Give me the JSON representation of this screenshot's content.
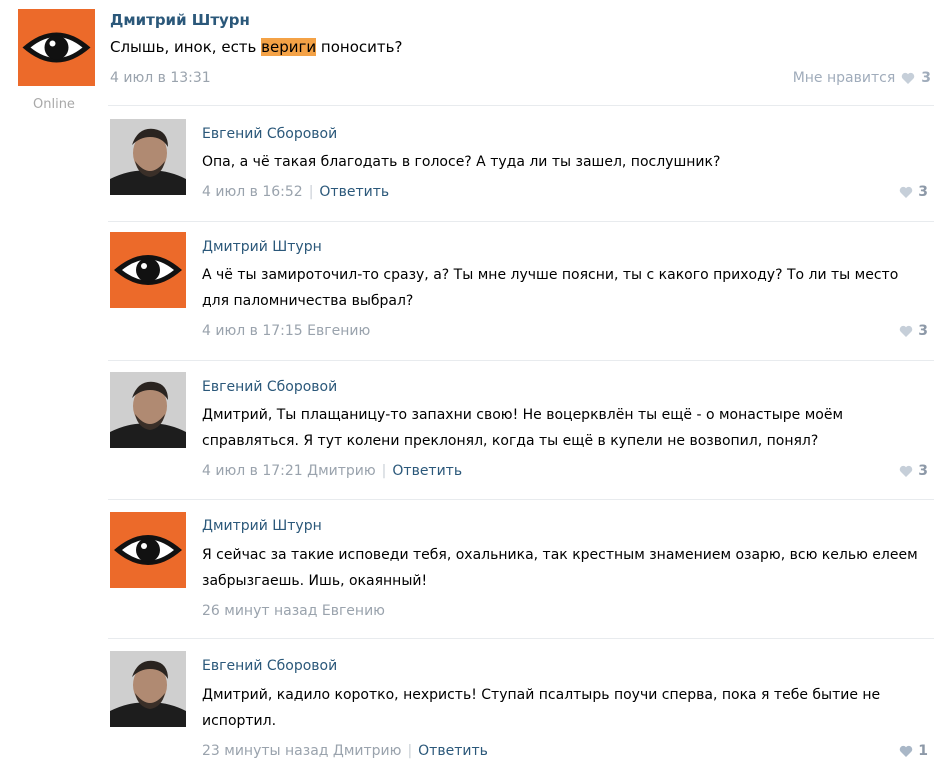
{
  "post": {
    "author": "Дмитрий Штурн",
    "text_before": "Слышь, инок, есть ",
    "text_highlight": "вериги",
    "text_after": " поносить?",
    "date": "4 июл в 13:31",
    "like_label": "Мне нравится",
    "like_count": "3",
    "online": "Online"
  },
  "replies": [
    {
      "author": "Евгений Сборовой",
      "text": "Опа, а чё такая благодать в голосе? А туда ли ты зашел, послушник?",
      "meta": "4 июл в 16:52",
      "reply_label": "Ответить",
      "likes": "3"
    },
    {
      "author": "Дмитрий Штурн",
      "text": "А чё ты замироточил-то сразу, а? Ты мне лучше поясни, ты с какого приходу? То ли ты место для паломничества выбрал?",
      "meta": "4 июл в 17:15 Евгению",
      "likes": "3"
    },
    {
      "author": "Евгений Сборовой",
      "text": "Дмитрий, Ты плащаницу-то запахни свою! Не воцерквлён ты ещё - о монастыре моём справляться. Я тут колени преклонял, когда ты ещё в купели не возвопил, понял?",
      "meta": "4 июл в 17:21 Дмитрию",
      "reply_label": "Ответить",
      "likes": "3"
    },
    {
      "author": "Дмитрий Штурн",
      "text": "Я сейчас за такие исповеди тебя, охальника, так крестным знамением озарю, всю келью елеем забрызгаешь. Ишь, окаянный!",
      "meta": "26 минут назад Евгению"
    },
    {
      "author": "Евгений Сборовой",
      "text": "Дмитрий, кадило коротко, нехристь! Ступай псалтырь поучи сперва, пока я тебе бытие не испортил.",
      "meta": "23 минуты назад Дмитрию",
      "reply_label": "Ответить",
      "likes": "1"
    }
  ],
  "colors": {
    "link": "#2b587a",
    "meta": "#9aa3ad",
    "avatar_orange": "#ec6a2a",
    "highlight": "#f4a246"
  },
  "icons": {
    "eye": "eye-logo-icon",
    "heart": "heart-icon"
  }
}
